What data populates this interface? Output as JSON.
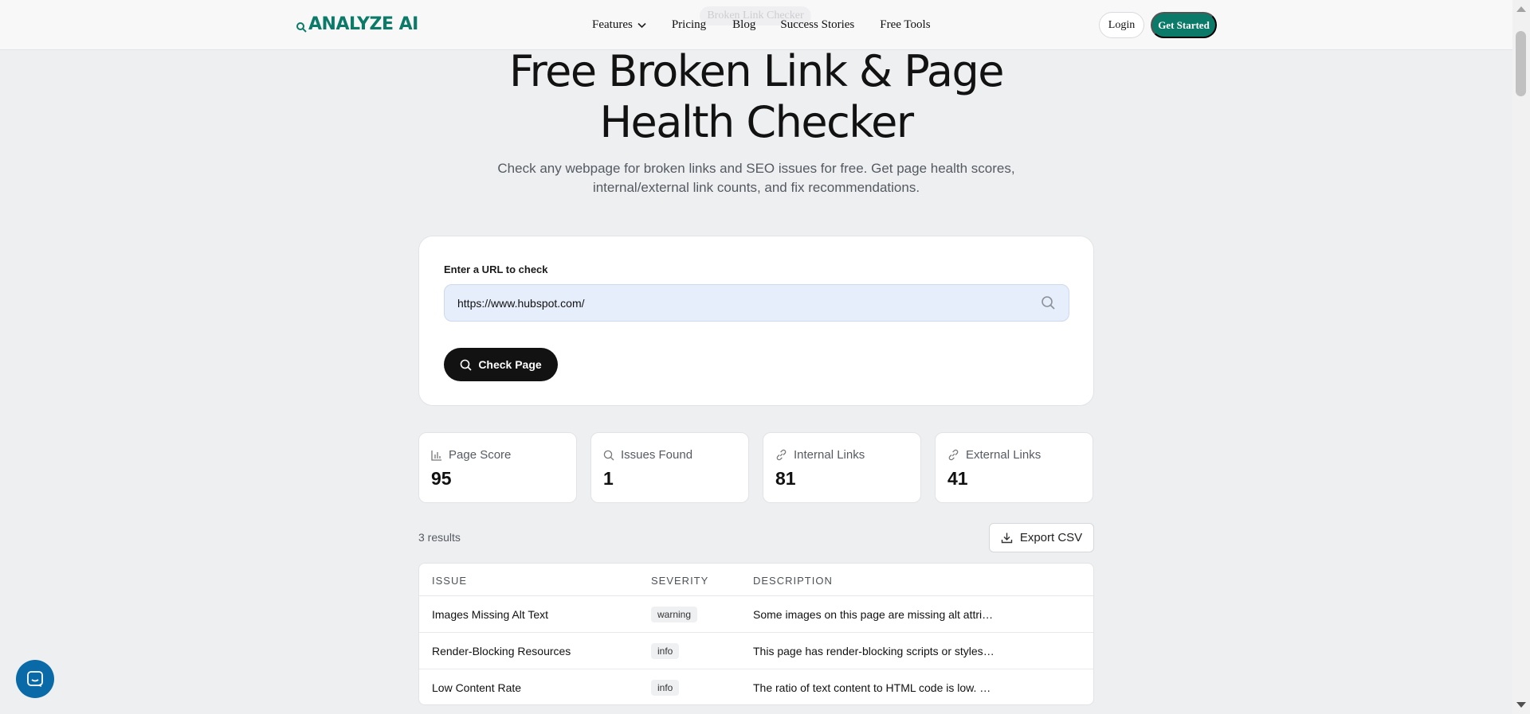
{
  "brand": {
    "name": "ANALYZE AI",
    "accent": "#0c7a68"
  },
  "nav": {
    "items": [
      {
        "label": "Features",
        "has_dropdown": true
      },
      {
        "label": "Pricing"
      },
      {
        "label": "Blog"
      },
      {
        "label": "Success Stories"
      },
      {
        "label": "Free Tools"
      }
    ],
    "ghost_tag": "Broken Link Checker",
    "login_label": "Login",
    "cta_label": "Get Started"
  },
  "hero": {
    "title_line1": "Free Broken Link & Page",
    "title_line2": "Health Checker",
    "subtitle_line1": "Check any webpage for broken links and SEO issues for free. Get page health scores,",
    "subtitle_line2": "internal/external link counts, and fix recommendations."
  },
  "form": {
    "label": "Enter a URL to check",
    "url_value": "https://www.hubspot.com/",
    "submit_label": "Check Page"
  },
  "stats": [
    {
      "icon": "bar-chart-icon",
      "label": "Page Score",
      "value": "95"
    },
    {
      "icon": "search-icon",
      "label": "Issues Found",
      "value": "1"
    },
    {
      "icon": "link-icon",
      "label": "Internal Links",
      "value": "81"
    },
    {
      "icon": "link-icon",
      "label": "External Links",
      "value": "41"
    }
  ],
  "results": {
    "count_text": "3 results",
    "export_label": "Export CSV",
    "columns": [
      "ISSUE",
      "SEVERITY",
      "DESCRIPTION"
    ],
    "rows": [
      {
        "issue": "Images Missing Alt Text",
        "severity": "warning",
        "description": "Some images on this page are missing alt attributes"
      },
      {
        "issue": "Render-Blocking Resources",
        "severity": "info",
        "description": "This page has render-blocking scripts or stylesheets"
      },
      {
        "issue": "Low Content Rate",
        "severity": "info",
        "description": "The ratio of text content to HTML code is low. Consider"
      }
    ]
  }
}
